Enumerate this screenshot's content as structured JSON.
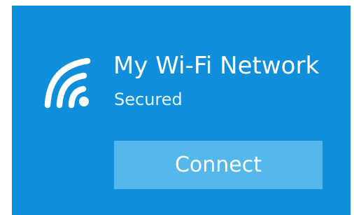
{
  "network": {
    "name": "My Wi-Fi Network",
    "status": "Secured",
    "icon": "wifi-icon"
  },
  "actions": {
    "connect_label": "Connect"
  },
  "colors": {
    "card_background": "#0f8fdb",
    "button_background": "#55b8ea",
    "text": "#ffffff"
  }
}
